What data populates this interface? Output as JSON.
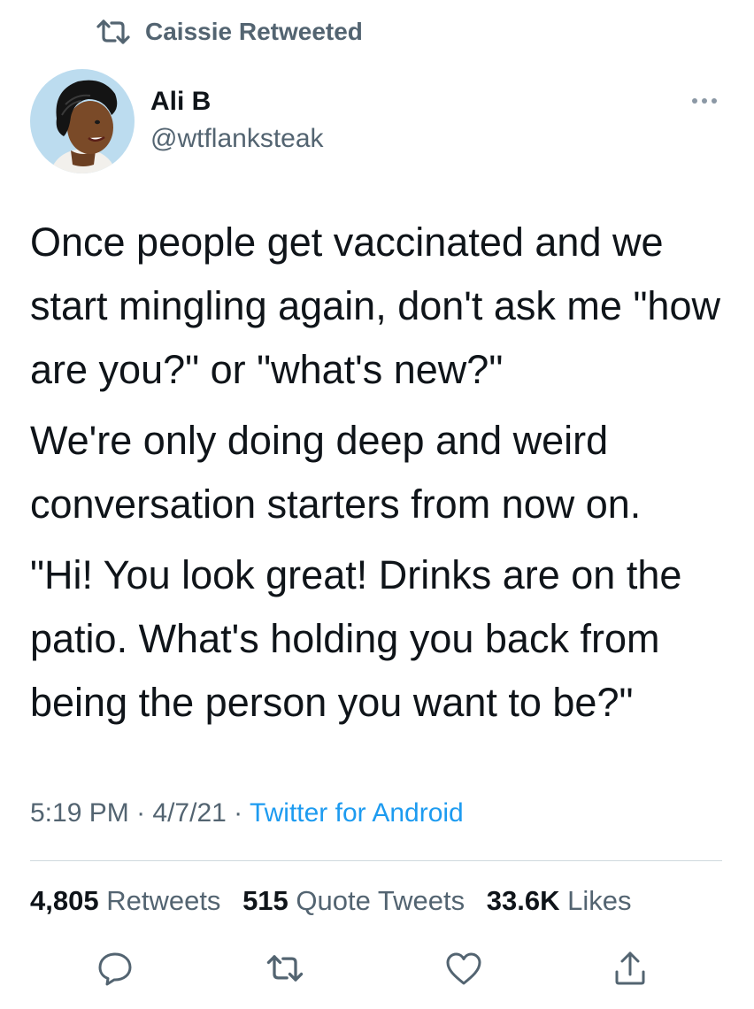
{
  "retweet_header": {
    "icon": "retweet-icon",
    "text": "Caissie Retweeted"
  },
  "author": {
    "avatar": "avatar",
    "name": "Ali B",
    "handle": "@wtflanksteak"
  },
  "more_icon": "more-icon",
  "tweet": {
    "paragraphs": [
      "Once people get vaccinated and we start mingling again, don't ask me \"how are you?\" or \"what's new?\"",
      "We're only doing deep and weird conversation starters from now on.",
      "\"Hi! You look great! Drinks are on the patio. What's holding you back from being the person you want to be?\""
    ]
  },
  "meta": {
    "time": "5:19 PM",
    "sep1": " · ",
    "date": "4/7/21",
    "sep2": " · ",
    "source": "Twitter for Android"
  },
  "stats": {
    "retweets_count": "4,805",
    "retweets_label": "Retweets",
    "quotes_count": "515",
    "quotes_label": "Quote Tweets",
    "likes_count": "33.6K",
    "likes_label": "Likes"
  },
  "actions": {
    "reply_icon": "reply-icon",
    "retweet_icon": "retweet-icon",
    "like_icon": "like-icon",
    "share_icon": "share-icon"
  },
  "colors": {
    "text": "#0f1419",
    "secondary": "#536471",
    "link": "#1d9bf0",
    "divider": "#cfd9de"
  }
}
